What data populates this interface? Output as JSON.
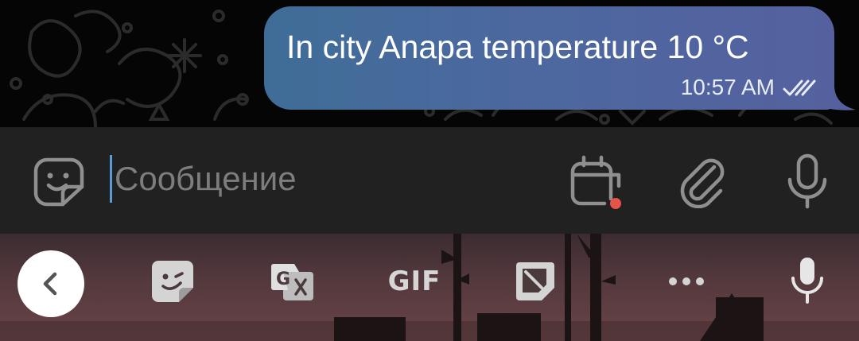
{
  "chat": {
    "message": {
      "text": "In city Anapa temperature 10 °C",
      "time": "10:57 AM",
      "status_icon": "double-check-icon",
      "bubble_colors": [
        "#3f6d97",
        "#55619f"
      ]
    }
  },
  "input_bar": {
    "placeholder": "Сообщение",
    "value": "",
    "icons": [
      "sticker-icon",
      "schedule-calendar-icon",
      "paperclip-icon",
      "microphone-icon"
    ],
    "accent_dot_color": "#e5534b",
    "caret_color": "#5b9bd5"
  },
  "keyboard_toolbar": {
    "items": [
      "back-chevron-icon",
      "sticker-icon",
      "translate-icon",
      "gif-icon",
      "clipboard-icon",
      "more-dots-icon",
      "voice-input-icon"
    ],
    "gif_label": "GIF"
  }
}
